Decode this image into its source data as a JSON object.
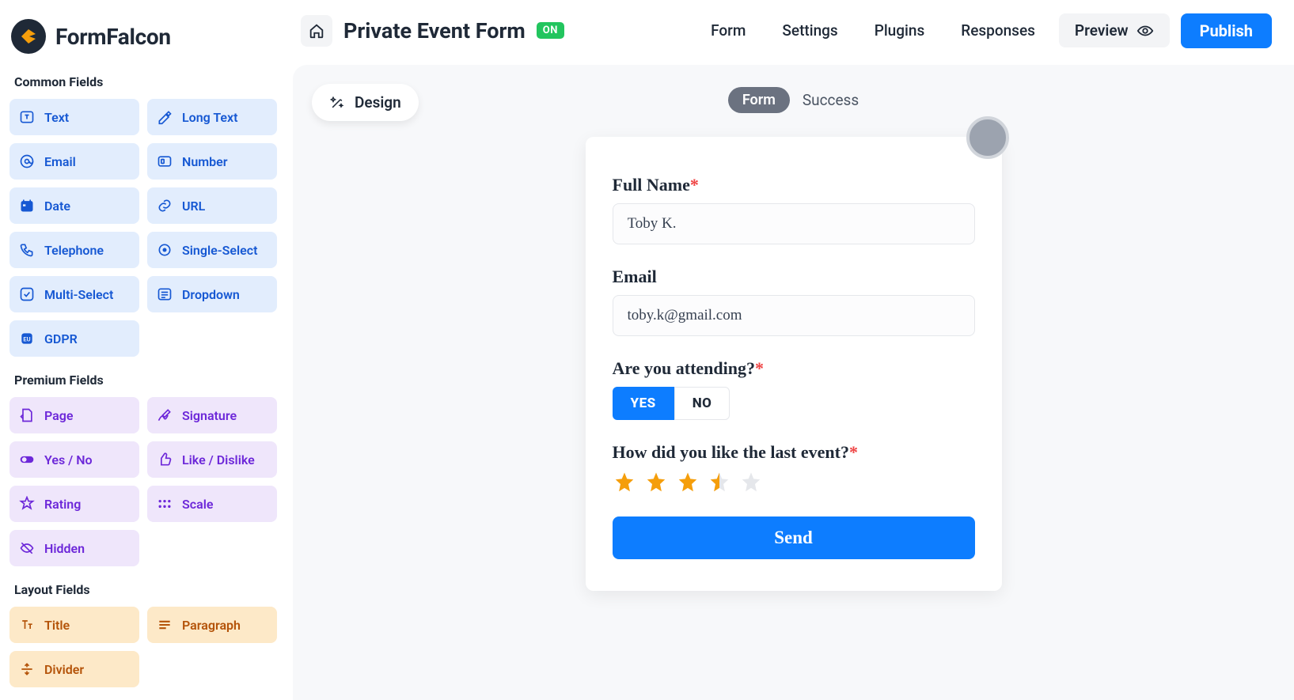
{
  "brand": {
    "name": "FormFalcon"
  },
  "sidebar": {
    "sections": {
      "common": {
        "title": "Common Fields",
        "items": [
          "Text",
          "Long Text",
          "Email",
          "Number",
          "Date",
          "URL",
          "Telephone",
          "Single-Select",
          "Multi-Select",
          "Dropdown",
          "GDPR"
        ]
      },
      "premium": {
        "title": "Premium Fields",
        "items": [
          "Page",
          "Signature",
          "Yes / No",
          "Like / Dislike",
          "Rating",
          "Scale",
          "Hidden"
        ]
      },
      "layout": {
        "title": "Layout Fields",
        "items": [
          "Title",
          "Paragraph",
          "Divider"
        ]
      }
    }
  },
  "header": {
    "form_title": "Private Event Form",
    "status_badge": "ON",
    "nav": [
      "Form",
      "Settings",
      "Plugins",
      "Responses"
    ],
    "preview": "Preview",
    "publish": "Publish"
  },
  "workarea": {
    "design_button": "Design",
    "tabs": {
      "active": "Form",
      "inactive": "Success"
    }
  },
  "form": {
    "fields": {
      "full_name": {
        "label": "Full Name",
        "required": true,
        "value": "Toby K."
      },
      "email": {
        "label": "Email",
        "required": false,
        "value": "toby.k@gmail.com"
      },
      "attending": {
        "label": "Are you attending?",
        "required": true,
        "yes": "YES",
        "no": "NO",
        "value": "YES"
      },
      "rating": {
        "label": "How did you like the last event?",
        "required": true,
        "value": 3.5,
        "max": 5
      }
    },
    "submit_label": "Send"
  },
  "colors": {
    "accent_blue": "#0d7dff",
    "common_chip_bg": "#e2edfd",
    "premium_chip_bg": "#efe6fb",
    "layout_chip_bg": "#fde9c8",
    "star_fill": "#f59e0b"
  }
}
